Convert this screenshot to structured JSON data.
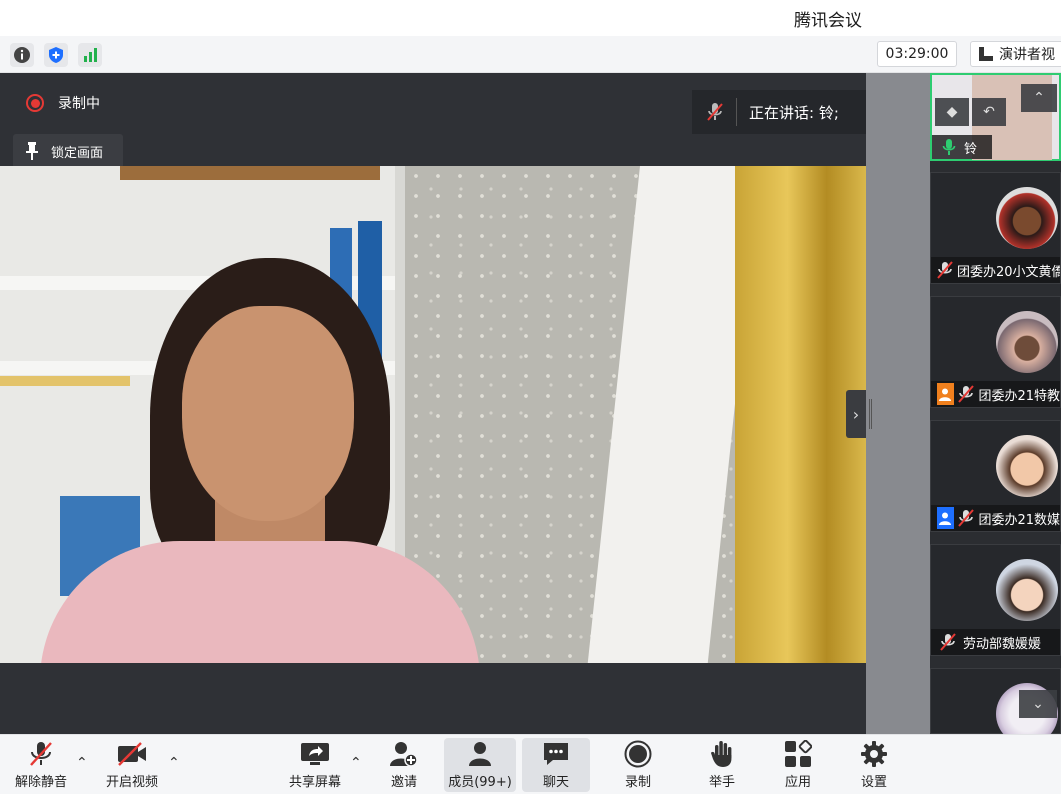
{
  "window": {
    "title": "腾讯会议"
  },
  "infobar": {
    "icons": [
      "info-icon",
      "shield-icon",
      "signal-icon"
    ],
    "timer": "03:29:00",
    "view_label": "演讲者视"
  },
  "stage": {
    "recording_label": "录制中",
    "lock_label": "锁定画面",
    "speaking_label": "正在讲话: 铃;"
  },
  "gallery": {
    "tiles": [
      {
        "name": "铃",
        "mic": "on",
        "active": true
      },
      {
        "name": "团委办20小文黄僑",
        "mic": "muted"
      },
      {
        "name": "团委办21特教",
        "mic": "muted",
        "tag": "orange"
      },
      {
        "name": "团委办21数媒",
        "mic": "muted",
        "tag": "blue"
      },
      {
        "name": "劳动部魏媛媛",
        "mic": "muted"
      },
      {
        "name": "",
        "mic": ""
      }
    ]
  },
  "toolbar": {
    "unmute": "解除静音",
    "start_video": "开启视频",
    "share_screen": "共享屏幕",
    "invite": "邀请",
    "members": "成员(99+)",
    "chat": "聊天",
    "record": "录制",
    "raise_hand": "举手",
    "apps": "应用",
    "settings": "设置"
  },
  "colors": {
    "recording": "#e53935",
    "active_speaker": "#2ecc71",
    "accent": "#1e6fff"
  }
}
